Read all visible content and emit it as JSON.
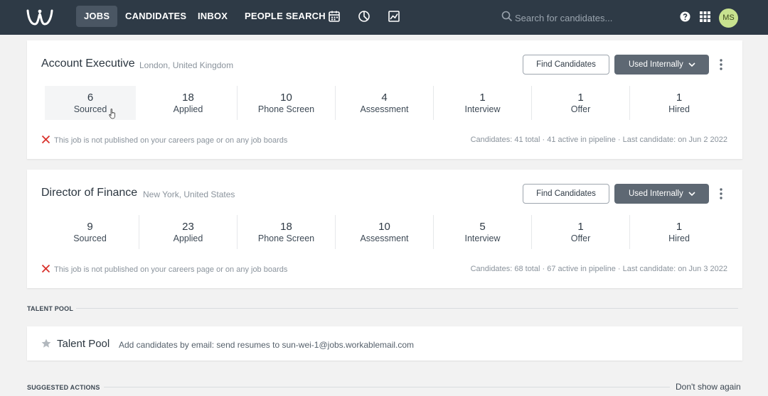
{
  "nav": {
    "items": [
      {
        "label": "JOBS",
        "active": true
      },
      {
        "label": "CANDIDATES"
      },
      {
        "label": "INBOX"
      },
      {
        "label": "PEOPLE SEARCH"
      }
    ],
    "icons": [
      "calendar-icon",
      "reports-icon",
      "analytics-icon"
    ],
    "search_placeholder": "Search for candidates...",
    "avatar_initials": "MS"
  },
  "jobs": [
    {
      "title": "Account Executive",
      "location": "London, United Kingdom",
      "find_label": "Find Candidates",
      "used_label": "Used Internally",
      "stages": [
        {
          "count": "6",
          "label": "Sourced"
        },
        {
          "count": "18",
          "label": "Applied"
        },
        {
          "count": "10",
          "label": "Phone Screen"
        },
        {
          "count": "4",
          "label": "Assessment"
        },
        {
          "count": "1",
          "label": "Interview"
        },
        {
          "count": "1",
          "label": "Offer"
        },
        {
          "count": "1",
          "label": "Hired"
        }
      ],
      "status": "This job is not published on your careers page or on any job boards",
      "meta": "Candidates: 41 total · 41 active in pipeline · Last candidate: on Jun 2 2022"
    },
    {
      "title": "Director of Finance",
      "location": "New York, United States",
      "find_label": "Find Candidates",
      "used_label": "Used Internally",
      "stages": [
        {
          "count": "9",
          "label": "Sourced"
        },
        {
          "count": "23",
          "label": "Applied"
        },
        {
          "count": "18",
          "label": "Phone Screen"
        },
        {
          "count": "10",
          "label": "Assessment"
        },
        {
          "count": "5",
          "label": "Interview"
        },
        {
          "count": "1",
          "label": "Offer"
        },
        {
          "count": "1",
          "label": "Hired"
        }
      ],
      "status": "This job is not published on your careers page or on any job boards",
      "meta": "Candidates: 68 total · 67 active in pipeline · Last candidate: on Jun 3 2022"
    }
  ],
  "talent_pool": {
    "section_label": "TALENT POOL",
    "title": "Talent Pool",
    "description": "Add candidates by email: send resumes to sun-wei-1@jobs.workablemail.com"
  },
  "suggested": {
    "section_label": "SUGGESTED ACTIONS",
    "dismiss_label": "Don't show again"
  },
  "colors": {
    "topbar": "#2e3a46",
    "error_red": "#d9312b",
    "button_dark": "#5e6873",
    "avatar": "#c8e28f"
  }
}
